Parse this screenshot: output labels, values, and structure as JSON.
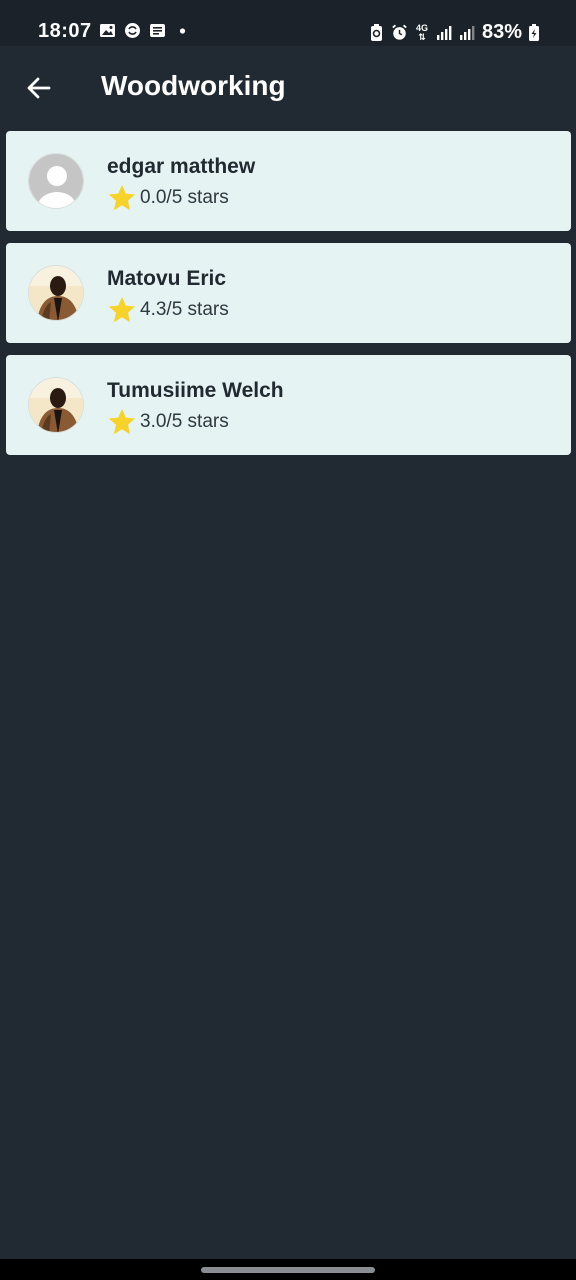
{
  "status_bar": {
    "time": "18:07",
    "left_icons": [
      "image-icon",
      "sync-icon",
      "message-icon",
      "dot-icon"
    ],
    "right_icons": [
      "battery-saver-icon",
      "alarm-icon",
      "network-4g-icon",
      "signal-icon",
      "signal-icon"
    ],
    "network_label": "4G",
    "battery_text": "83%"
  },
  "app_bar": {
    "back_icon": "arrow-left-icon",
    "title": "Woodworking"
  },
  "workers": [
    {
      "name": "edgar matthew",
      "rating_text": "0.0/5 stars",
      "avatar": "default-avatar-icon"
    },
    {
      "name": "Matovu Eric",
      "rating_text": "4.3/5 stars",
      "avatar": "photo-avatar"
    },
    {
      "name": "Tumusiime Welch",
      "rating_text": "3.0/5 stars",
      "avatar": "photo-avatar"
    }
  ],
  "colors": {
    "background": "#212a33",
    "card": "#e5f4f3",
    "star": "#f6d22a",
    "text_dark": "#222a31"
  }
}
